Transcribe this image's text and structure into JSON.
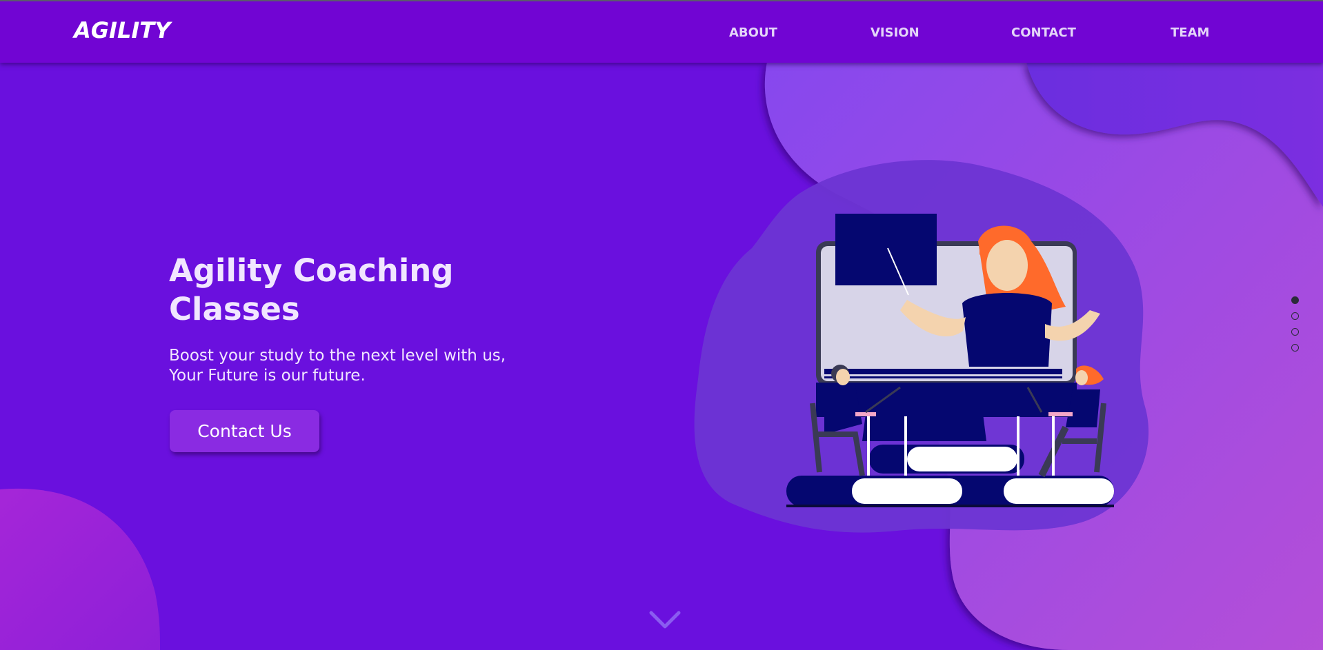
{
  "nav": {
    "logo": "AGILITY",
    "links": [
      "ABOUT",
      "VISION",
      "CONTACT",
      "TEAM"
    ]
  },
  "hero": {
    "title": "Agility Coaching Classes",
    "subtitle": "Boost your study to the next level with us, Your Future is our future.",
    "cta_label": "Contact Us"
  },
  "slider": {
    "active_index": 0,
    "count": 4
  },
  "icons": {
    "scroll": "chevron-down-icon",
    "illustration": "online-class-illustration"
  },
  "colors": {
    "background": "#6a10de",
    "navbar": "#7105d3",
    "accent": "#8a2be2",
    "illustration_navy": "#050770",
    "teacher_hair": "#ff6a2b"
  }
}
